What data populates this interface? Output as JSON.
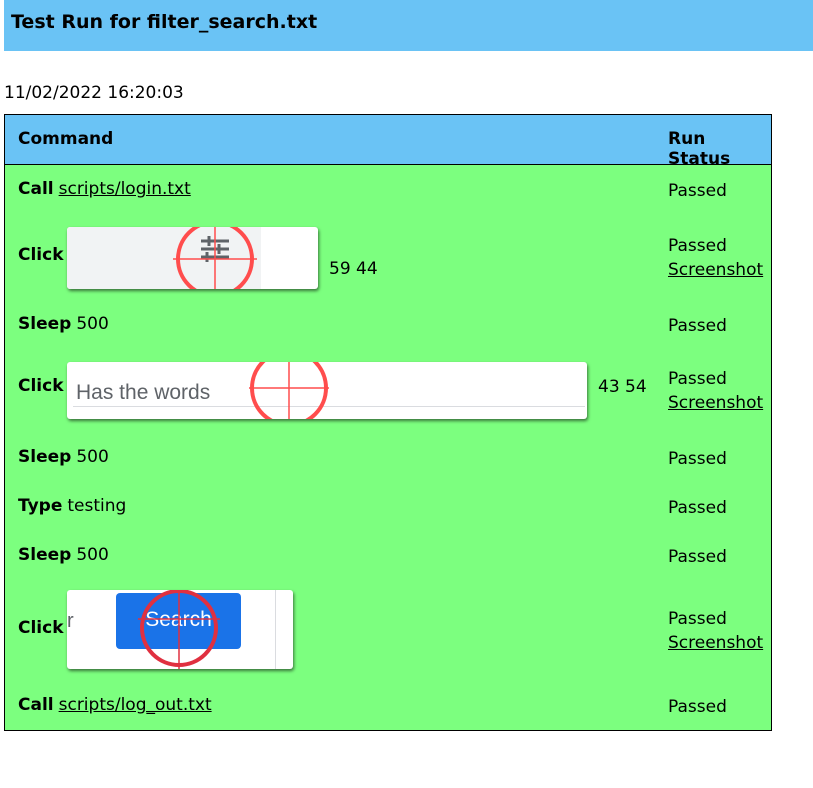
{
  "title": "Test Run for filter_search.txt",
  "timestamp": "11/02/2022 16:20:03",
  "columns": {
    "command": "Command",
    "status": "Run Status"
  },
  "rows": [
    {
      "command": "Call",
      "arg": "scripts/login.txt",
      "status": "Passed"
    },
    {
      "command": "Click",
      "coords": "59 44",
      "status": "Passed",
      "screenshot": "Screenshot",
      "thumb_icon": "tune-icon"
    },
    {
      "command": "Sleep",
      "arg": "500",
      "status": "Passed"
    },
    {
      "command": "Click",
      "coords": "43 54",
      "status": "Passed",
      "screenshot": "Screenshot",
      "thumb_text": "Has the words"
    },
    {
      "command": "Sleep",
      "arg": "500",
      "status": "Passed"
    },
    {
      "command": "Type",
      "arg": "testing",
      "status": "Passed"
    },
    {
      "command": "Sleep",
      "arg": "500",
      "status": "Passed"
    },
    {
      "command": "Click",
      "status": "Passed",
      "screenshot": "Screenshot",
      "thumb_button": "Search",
      "thumb_prefix": "r"
    },
    {
      "command": "Call",
      "arg": "scripts/log_out.txt",
      "status": "Passed"
    }
  ],
  "colors": {
    "header": "#6ac3f5",
    "passed_row": "#7cff7f",
    "crosshair": "#ff4d4d",
    "search_button": "#1a73e8"
  }
}
